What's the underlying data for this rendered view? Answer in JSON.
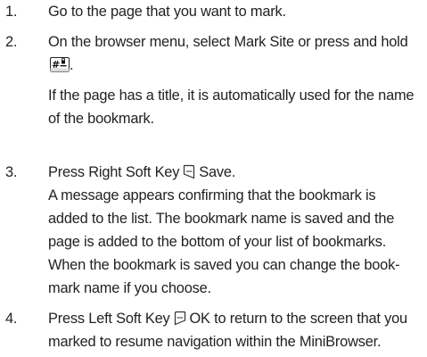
{
  "steps": [
    {
      "number": "1.",
      "lines": [
        "Go to the page that you want to mark."
      ]
    },
    {
      "number": "2.",
      "lines": [
        "On the browser menu, select Mark Site or press and hold"
      ],
      "trailing": ".",
      "key_icon": "pound-space-key-icon",
      "note_lines": [
        "If the page has a title, it is automatically used for the name",
        "of the bookmark."
      ]
    },
    {
      "number": "3.",
      "text_before": "Press Right Soft Key",
      "softkey_icon": "right-soft-key-icon",
      "text_after": "Save.",
      "lines": [
        "A message appears confirming that the bookmark is",
        "added to the list. The bookmark name is saved and the",
        "page is added to the bottom of your list of bookmarks.",
        "When the bookmark is saved you can change the book-",
        "mark name if you choose."
      ]
    },
    {
      "number": "4.",
      "text_before": "Press Left Soft Key",
      "softkey_icon": "left-soft-key-icon",
      "text_after": "OK to return to the screen that you",
      "lines": [
        "marked to resume navigation within the MiniBrowser."
      ]
    }
  ]
}
